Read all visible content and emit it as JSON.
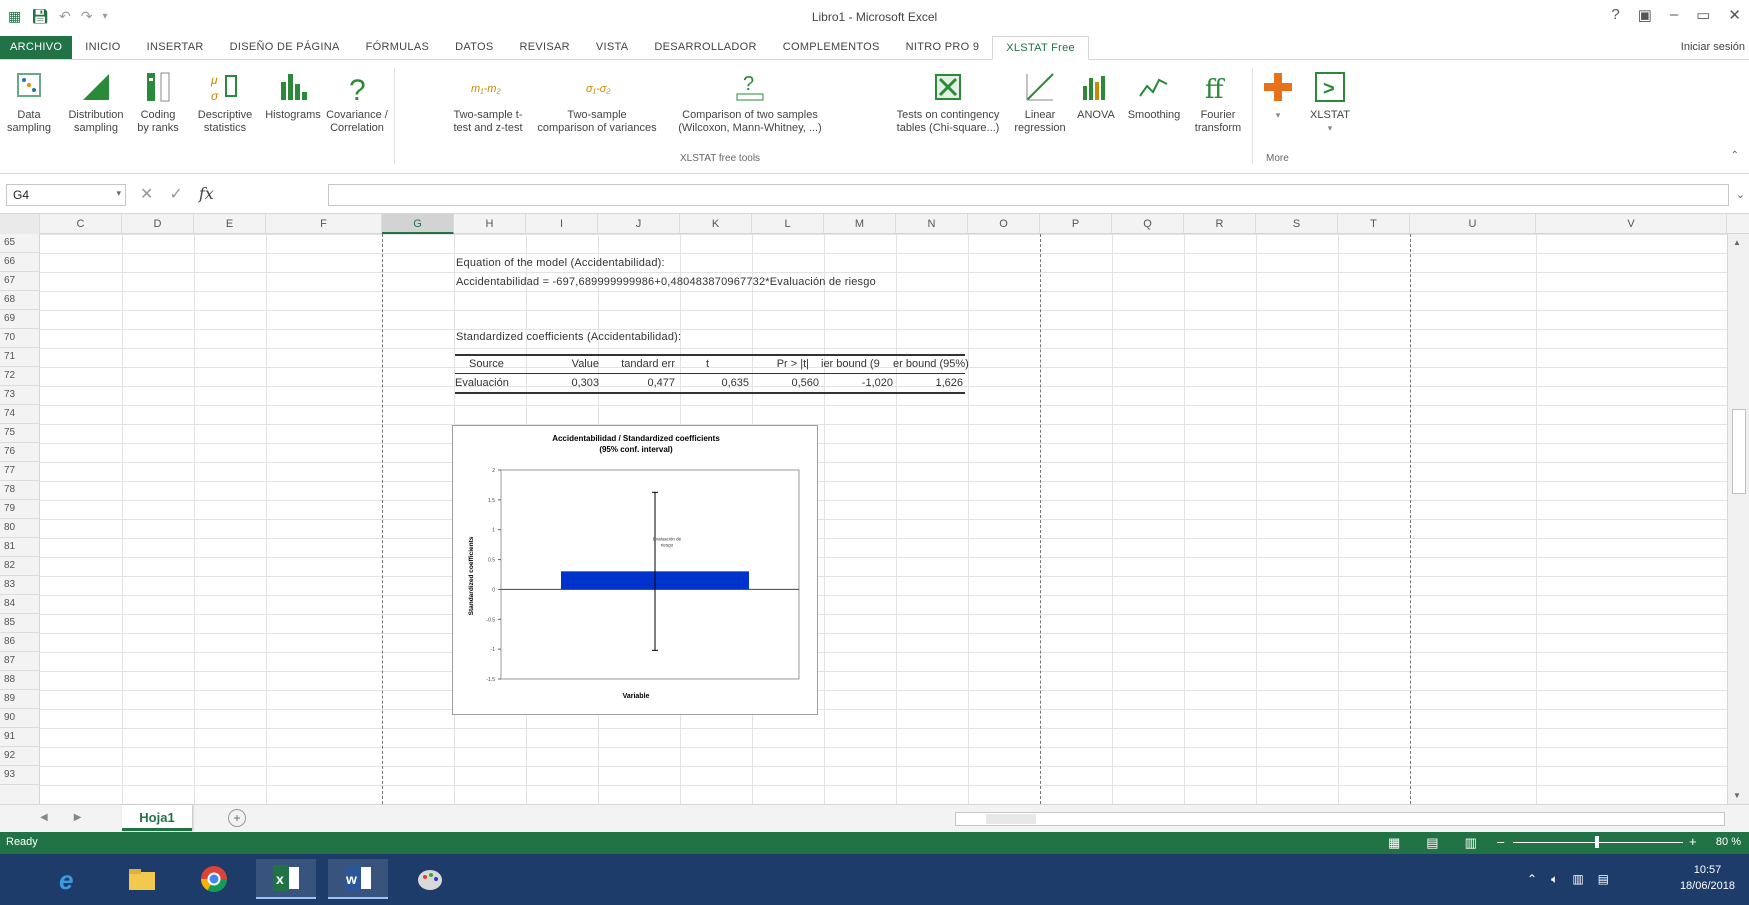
{
  "window": {
    "title": "Libro1 - Microsoft Excel",
    "controls": [
      "?",
      "▣",
      "–",
      "▭",
      "✕"
    ]
  },
  "tabs": {
    "items": [
      "ARCHIVO",
      "INICIO",
      "INSERTAR",
      "DISEÑO DE PÁGINA",
      "FÓRMULAS",
      "DATOS",
      "REVISAR",
      "VISTA",
      "DESARROLLADOR",
      "COMPLEMENTOS",
      "NITRO PRO 9",
      "XLSTAT Free"
    ],
    "active": "XLSTAT Free",
    "signin": "Iniciar sesión"
  },
  "ribbon": {
    "buttons": [
      {
        "line1": "Data",
        "line2": "sampling",
        "icon": "dice-icon"
      },
      {
        "line1": "Distribution",
        "line2": "sampling",
        "icon": "distribution-icon"
      },
      {
        "line1": "Coding",
        "line2": "by ranks",
        "icon": "coding-icon"
      },
      {
        "line1": "Descriptive",
        "line2": "statistics",
        "icon": "descriptive-icon"
      },
      {
        "line1": "Histograms",
        "line2": "",
        "icon": "histogram-icon"
      },
      {
        "line1": "Covariance /",
        "line2": "Correlation",
        "icon": "question-icon"
      },
      {
        "line1": "Two-sample t-",
        "line2": "test and z-test",
        "icon": "m1m2-icon"
      },
      {
        "line1": "Two-sample",
        "line2": "comparison of variances",
        "icon": "variance-icon"
      },
      {
        "line1": "Comparison of two samples",
        "line2": "(Wilcoxon, Mann-Whitney, ...)",
        "icon": "compare-icon"
      },
      {
        "line1": "Tests on contingency",
        "line2": "tables (Chi-square...)",
        "icon": "contingency-icon"
      },
      {
        "line1": "Linear",
        "line2": "regression",
        "icon": "regression-icon"
      },
      {
        "line1": "ANOVA",
        "line2": "",
        "icon": "anova-icon"
      },
      {
        "line1": "Smoothing",
        "line2": "",
        "icon": "smoothing-icon"
      },
      {
        "line1": "Fourier",
        "line2": "transform",
        "icon": "fourier-icon"
      },
      {
        "line1": "",
        "line2": "",
        "icon": "plus-icon"
      },
      {
        "line1": "XLSTAT",
        "line2": "",
        "icon": "xlstat-icon"
      }
    ],
    "group_label": "XLSTAT free tools",
    "more_label": "More"
  },
  "formula_bar": {
    "name_box": "G4",
    "fx": "fx",
    "value": ""
  },
  "columns": [
    "C",
    "D",
    "E",
    "F",
    "G",
    "H",
    "I",
    "J",
    "K",
    "L",
    "M",
    "N",
    "O",
    "P",
    "Q",
    "R",
    "S",
    "T",
    "U",
    "V"
  ],
  "selected_column": "G",
  "rows": [
    "65",
    "66",
    "67",
    "68",
    "69",
    "70",
    "71",
    "72",
    "73",
    "74",
    "75",
    "76",
    "77",
    "78",
    "79",
    "80",
    "81",
    "82",
    "83",
    "84",
    "85",
    "86",
    "87",
    "88",
    "89",
    "90",
    "91",
    "92",
    "93"
  ],
  "cells": {
    "equation_title": "Equation of the model (Accidentabilidad):",
    "equation": "Accidentabilidad = -697,689999999986+0,480483870967732*Evaluación de riesgo",
    "std_title": "Standardized coefficients (Accidentabilidad):"
  },
  "std_table": {
    "headers": [
      "Source",
      "Value",
      "tandard err",
      "t",
      "Pr > |t|",
      "ier bound (9",
      "er bound (95%)"
    ],
    "row": [
      "Evaluación",
      "0,303",
      "0,477",
      "0,635",
      "0,560",
      "-1,020",
      "1,626"
    ]
  },
  "chart_data": {
    "type": "bar",
    "title": "Accidentabilidad / Standardized coefficients",
    "subtitle": "(95% conf. interval)",
    "xlabel": "Variable",
    "ylabel": "Standardized coefficients",
    "categories": [
      "Evaluación de riesgo"
    ],
    "values": [
      0.303
    ],
    "error_low": [
      -1.02
    ],
    "error_high": [
      1.626
    ],
    "ylim": [
      -1.5,
      2
    ],
    "yticks": [
      "2",
      "1.5",
      "1",
      "0.5",
      "0",
      "-0.5",
      "-1",
      "-1.5"
    ],
    "bar_color": "#0033cc"
  },
  "sheet": {
    "tab": "Hoja1",
    "add": "+"
  },
  "status": {
    "ready": "Ready",
    "zoom": "80 %"
  },
  "taskbar": {
    "time": "10:57",
    "date": "18/06/2018",
    "apps": [
      "ie-icon",
      "explorer-icon",
      "chrome-icon",
      "excel-icon",
      "word-icon",
      "paint-icon"
    ]
  },
  "colors": {
    "excel_green": "#217346",
    "taskbar": "#1d3c6a"
  }
}
